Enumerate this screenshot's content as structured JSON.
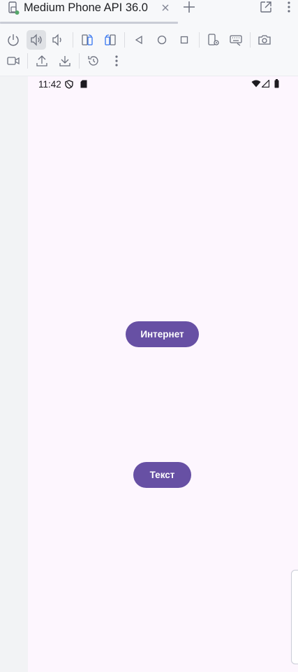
{
  "tab": {
    "title": "Medium Phone API 36.0",
    "icons": {
      "device": "device-running-icon",
      "close": "close-icon",
      "new_tab": "plus-icon",
      "external": "open-external-icon",
      "more": "more-vertical-icon"
    }
  },
  "toolbar": {
    "icons": [
      "power-icon",
      "volume-up-icon",
      "volume-down-icon",
      "rotate-left-icon",
      "rotate-right-icon",
      "back-icon",
      "home-icon",
      "overview-icon",
      "device-settings-icon",
      "keyboard-icon",
      "screenshot-icon",
      "screen-record-icon",
      "upload-icon",
      "download-icon",
      "reset-icon",
      "more-vertical-icon"
    ],
    "active": "volume-up-icon"
  },
  "status_bar": {
    "time": "11:42",
    "icons": [
      "shield-icon",
      "sd-card-icon",
      "wifi-icon",
      "signal-icon",
      "battery-icon"
    ]
  },
  "app": {
    "internet_button": "Интернет",
    "text_button": "Текст"
  },
  "colors": {
    "accent": "#6750a4",
    "screen_background": "#fdf6fe",
    "ide_background": "#f7f8fa"
  }
}
